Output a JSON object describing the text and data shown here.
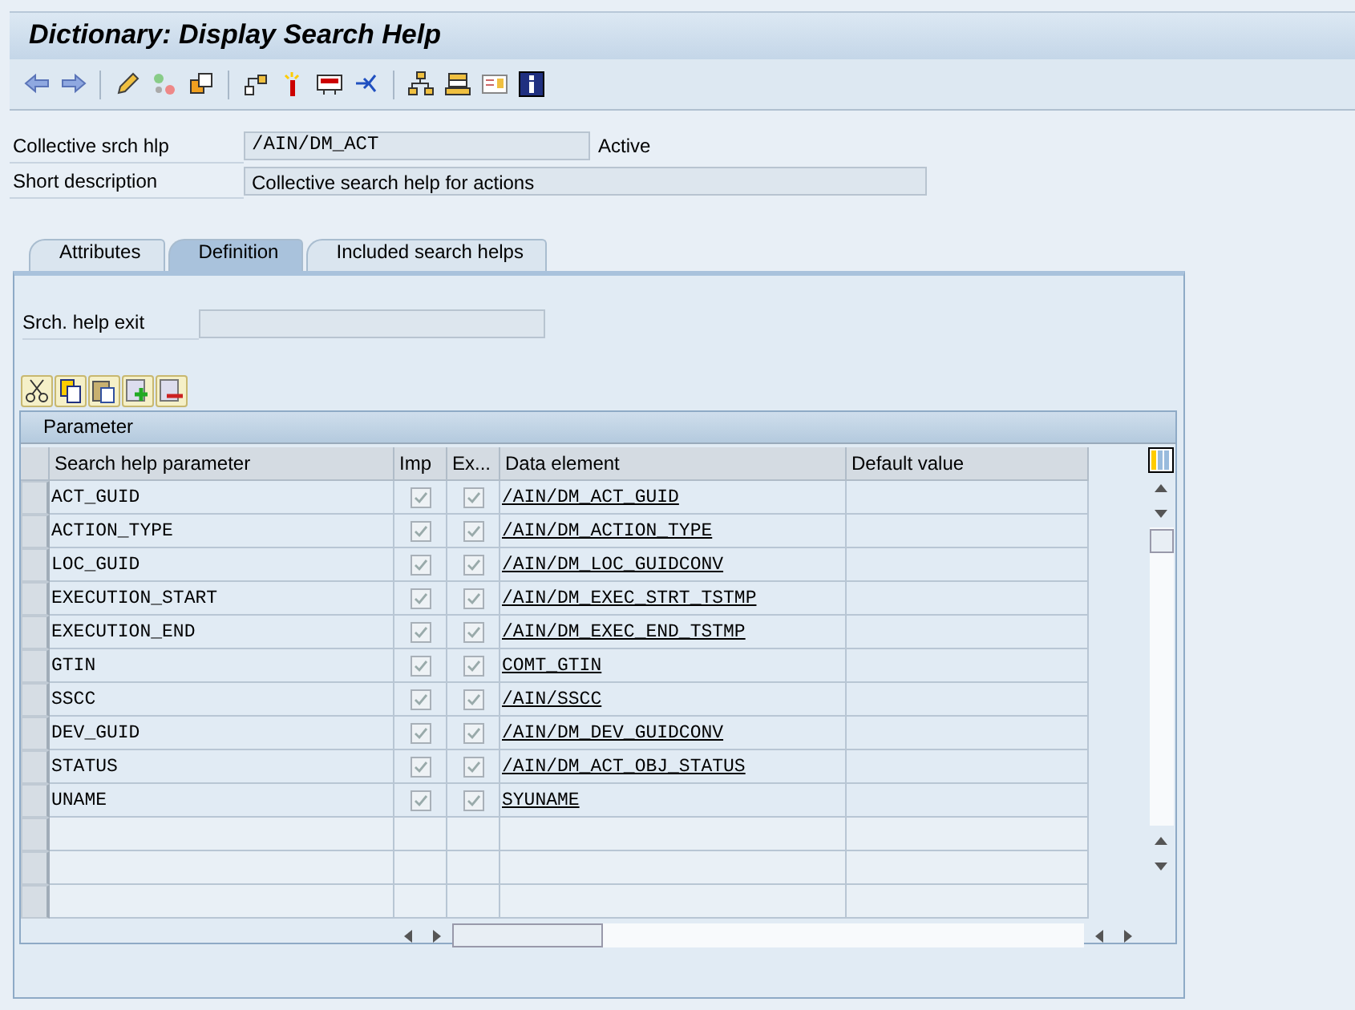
{
  "window": {
    "title": "Dictionary: Display Search Help"
  },
  "header_fields": [
    {
      "label": "Collective srch hlp",
      "value": "/AIN/DM_ACT",
      "mono": true,
      "status": "Active"
    },
    {
      "label": "Short description",
      "value": "Collective search help for actions",
      "mono": false
    }
  ],
  "tabs": [
    {
      "label": "Attributes",
      "selected": false
    },
    {
      "label": "Definition",
      "selected": true
    },
    {
      "label": "Included search helps",
      "selected": false
    }
  ],
  "exit_field": {
    "label": "Srch. help exit"
  },
  "table": {
    "title": "Parameter",
    "columns": [
      "Search help parameter",
      "Imp",
      "Ex...",
      "Data element",
      "Default value"
    ],
    "rows": [
      {
        "parameter": "ACT_GUID",
        "imp": true,
        "exp": true,
        "data_element": "/AIN/DM_ACT_GUID"
      },
      {
        "parameter": "ACTION_TYPE",
        "imp": true,
        "exp": true,
        "data_element": "/AIN/DM_ACTION_TYPE"
      },
      {
        "parameter": "LOC_GUID",
        "imp": true,
        "exp": true,
        "data_element": "/AIN/DM_LOC_GUIDCONV"
      },
      {
        "parameter": "EXECUTION_START",
        "imp": true,
        "exp": true,
        "data_element": "/AIN/DM_EXEC_STRT_TSTMP"
      },
      {
        "parameter": "EXECUTION_END",
        "imp": true,
        "exp": true,
        "data_element": "/AIN/DM_EXEC_END_TSTMP"
      },
      {
        "parameter": "GTIN",
        "imp": true,
        "exp": true,
        "data_element": "COMT_GTIN"
      },
      {
        "parameter": "SSCC",
        "imp": true,
        "exp": true,
        "data_element": "/AIN/SSCC"
      },
      {
        "parameter": "DEV_GUID",
        "imp": true,
        "exp": true,
        "data_element": "/AIN/DM_DEV_GUIDCONV"
      },
      {
        "parameter": "STATUS",
        "imp": true,
        "exp": true,
        "data_element": "/AIN/DM_ACT_OBJ_STATUS"
      },
      {
        "parameter": "UNAME",
        "imp": true,
        "exp": true,
        "data_element": "SYUNAME"
      }
    ]
  }
}
